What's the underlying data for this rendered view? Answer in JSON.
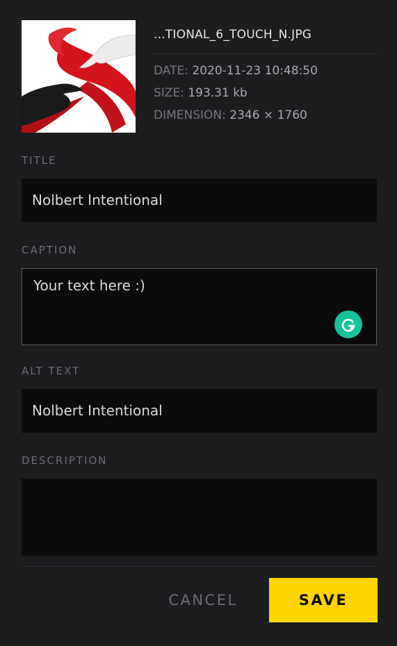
{
  "file": {
    "name": "...TIONAL_6_TOUCH_N.JPG",
    "thumbnail_icon": "image-thumbnail",
    "meta": [
      {
        "key": "DATE:",
        "value": "2020-11-23 10:48:50"
      },
      {
        "key": "SIZE:",
        "value": "193.31 kb"
      },
      {
        "key": "DIMENSION:",
        "value": "2346 × 1760"
      }
    ]
  },
  "form": {
    "title": {
      "label": "TITLE",
      "value": "Nolbert Intentional"
    },
    "caption": {
      "label": "CAPTION",
      "value": "Your text here :)"
    },
    "alt": {
      "label": "ALT TEXT",
      "value": "Nolbert Intentional"
    },
    "description": {
      "label": "DESCRIPTION",
      "value": ""
    }
  },
  "grammarly_icon": "grammarly-icon",
  "actions": {
    "cancel": "CANCEL",
    "save": "SAVE"
  },
  "colors": {
    "background": "#1c1d1f",
    "field": "#0b0b0b",
    "accent": "#ffd400",
    "grammarly": "#15c39a"
  }
}
